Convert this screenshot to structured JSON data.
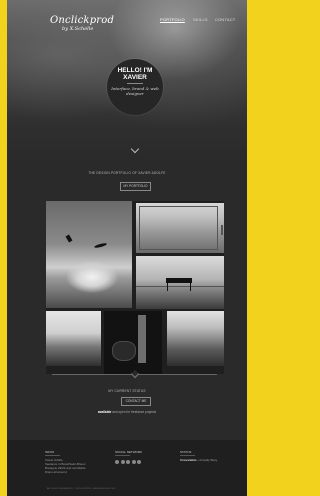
{
  "brand": {
    "logo_line1": "Onclickprod",
    "logo_line2": "by X.Schelle"
  },
  "nav": {
    "items": [
      "PORTFOLIO",
      "SKILLS",
      "CONTACT"
    ]
  },
  "hero": {
    "title": "HELLO! I'M XAVIER",
    "subtitle": "Interface, brand & web designer"
  },
  "portfolio": {
    "tagline": "THE DESIGN PORTFOLIO OF XAVIER ADOLFE",
    "button": "MY PORTFOLIO"
  },
  "status": {
    "title": "MY CURRENT STATUS",
    "button": "CONTACT ME",
    "availability_bold": "available",
    "availability_rest": "and open for freelance projects"
  },
  "footer": {
    "col1": {
      "title": "INFOS",
      "lines": [
        "Xavier Adolfe",
        "freelance in Brest/Saint-Brieuc",
        "Bretagne 29/22 and worldwide",
        "Dispo all around"
      ]
    },
    "col2": {
      "title": "SOCIAL NETWORK"
    },
    "col3": {
      "title": "STATUS",
      "lines": [
        "Unavailable",
        "Actually Busy"
      ]
    },
    "copyright": "ALL RIGHTS RESERVED © ONCLICKPROD | XAVIER ADOLFE 2013"
  },
  "icons": [
    "chevron-down-icon",
    "twitter-icon",
    "facebook-icon",
    "dribbble-icon",
    "linkedin-icon",
    "behance-icon"
  ]
}
